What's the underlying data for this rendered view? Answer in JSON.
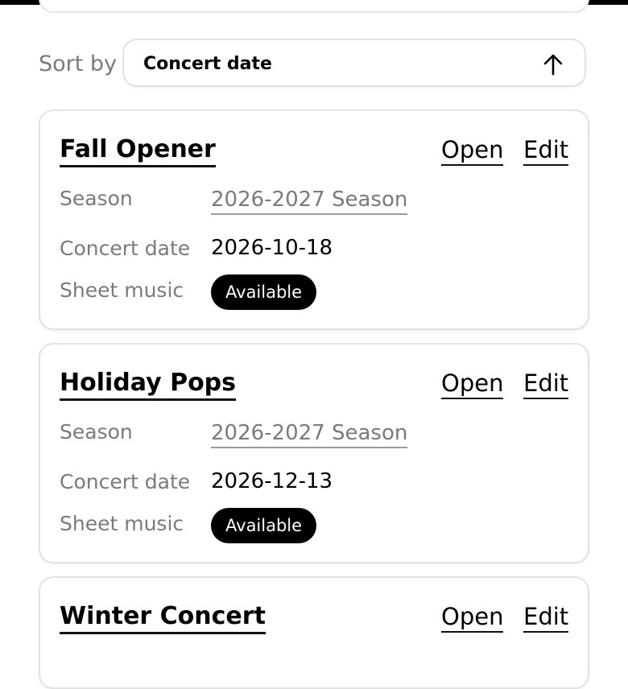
{
  "sort": {
    "label": "Sort by",
    "value": "Concert date",
    "direction_icon": "arrow-up-icon"
  },
  "field_labels": {
    "season": "Season",
    "concert_date": "Concert date",
    "sheet_music": "Sheet music"
  },
  "actions": {
    "open": "Open",
    "edit": "Edit"
  },
  "concerts": [
    {
      "title": "Fall Opener",
      "season": "2026-2027 Season",
      "concert_date": "2026-10-18",
      "sheet_music": "Available"
    },
    {
      "title": "Holiday Pops",
      "season": "2026-2027 Season",
      "concert_date": "2026-12-13",
      "sheet_music": "Available"
    },
    {
      "title": "Winter Concert"
    }
  ]
}
